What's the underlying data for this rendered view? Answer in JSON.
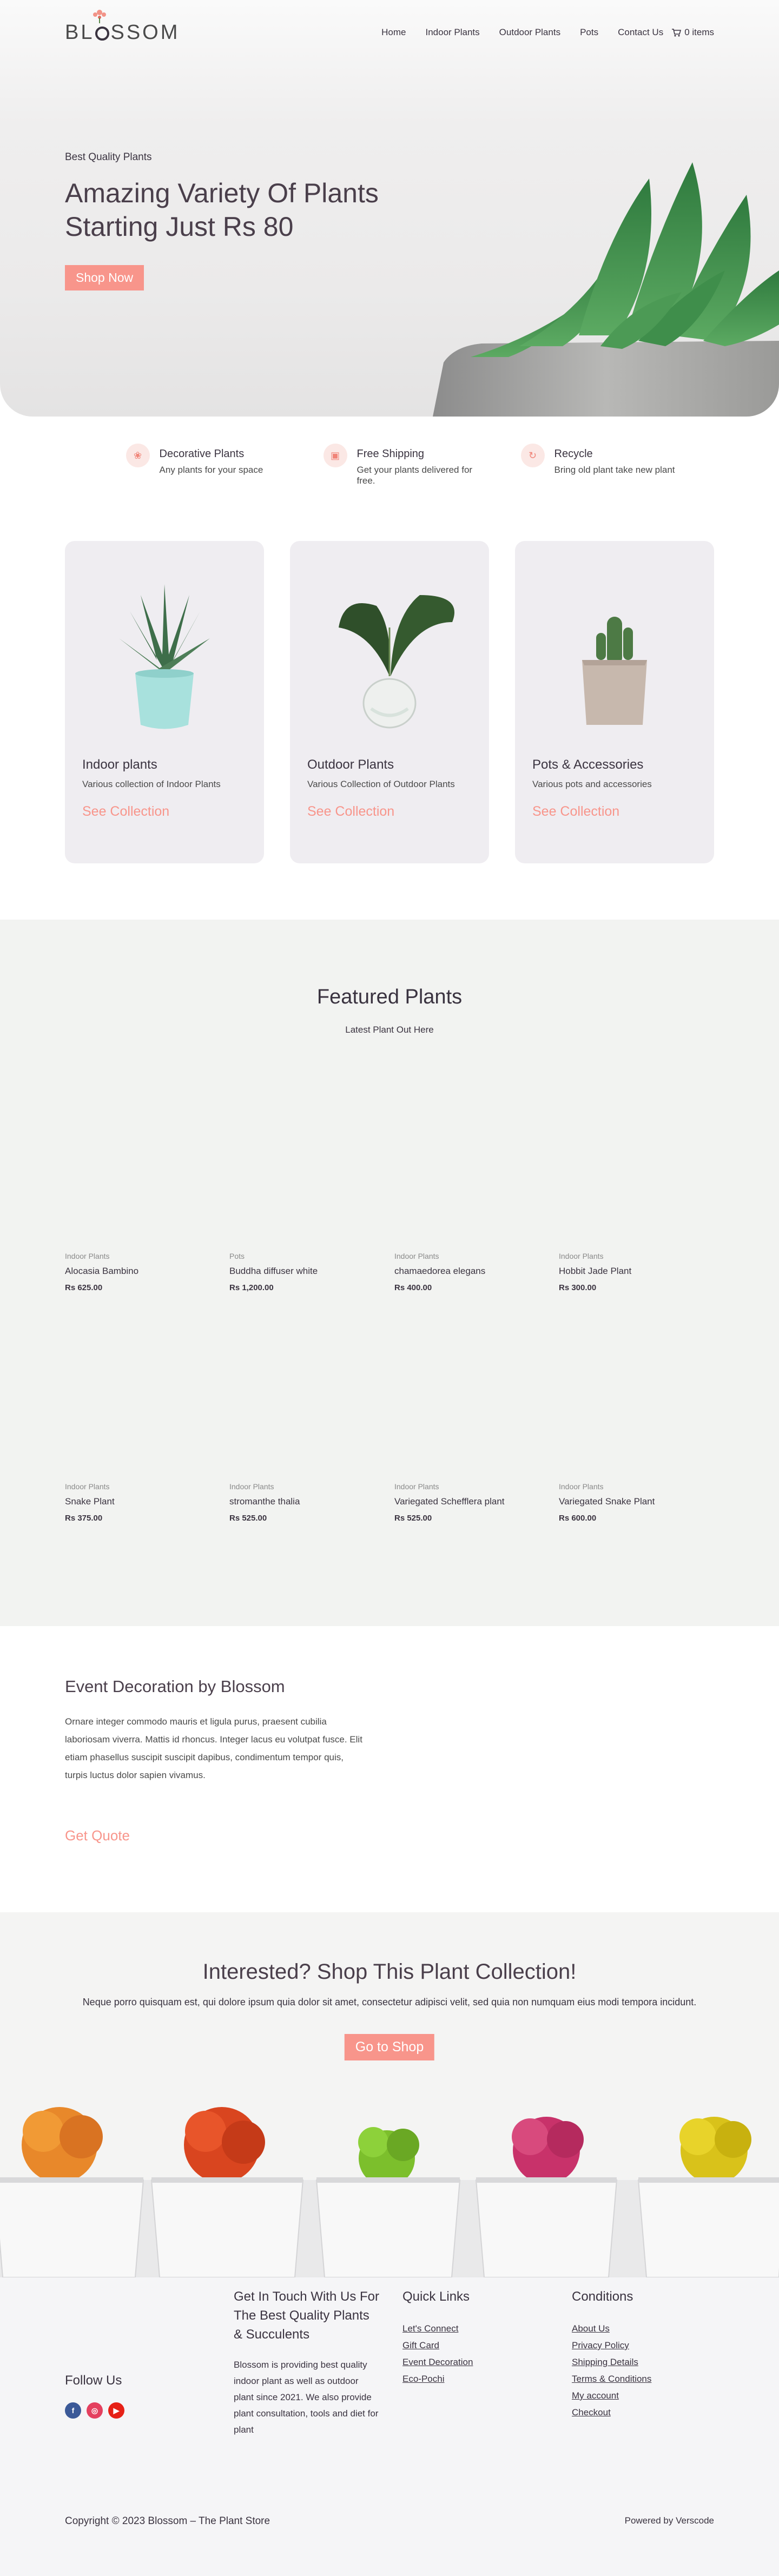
{
  "header": {
    "logo": "BLOSSOM",
    "nav": [
      "Home",
      "Indoor Plants",
      "Outdoor Plants",
      "Pots",
      "Contact Us"
    ],
    "cart": "0 items"
  },
  "hero": {
    "eyebrow": "Best Quality Plants",
    "title": "Amazing Variety Of Plants Starting Just Rs 80",
    "button": "Shop Now"
  },
  "features": [
    {
      "title": "Decorative Plants",
      "text": "Any plants for your space",
      "icon": "lotus-icon"
    },
    {
      "title": "Free Shipping",
      "text": "Get your plants delivered for free.",
      "icon": "box-icon"
    },
    {
      "title": "Recycle",
      "text": "Bring old plant take new plant",
      "icon": "recycle-icon"
    }
  ],
  "categories": [
    {
      "title": "Indoor plants",
      "text": "Various collection of Indoor Plants",
      "link": "See Collection"
    },
    {
      "title": "Outdoor Plants",
      "text": "Various Collection of Outdoor Plants",
      "link": "See Collection"
    },
    {
      "title": "Pots & Accessories",
      "text": "Various pots and accessories",
      "link": "See Collection"
    }
  ],
  "featured": {
    "title": "Featured Plants",
    "subtitle": "Latest Plant Out Here",
    "products": [
      {
        "category": "Indoor Plants",
        "name": "Alocasia Bambino",
        "price": "Rs 625.00"
      },
      {
        "category": "Pots",
        "name": "Buddha diffuser white",
        "price": "Rs 1,200.00"
      },
      {
        "category": "Indoor Plants",
        "name": "chamaedorea elegans",
        "price": "Rs 400.00"
      },
      {
        "category": "Indoor Plants",
        "name": "Hobbit Jade Plant",
        "price": "Rs 300.00"
      },
      {
        "category": "Indoor Plants",
        "name": "Snake Plant",
        "price": "Rs 375.00"
      },
      {
        "category": "Indoor Plants",
        "name": "stromanthe thalia",
        "price": "Rs 525.00"
      },
      {
        "category": "Indoor Plants",
        "name": "Variegated Schefflera plant",
        "price": "Rs 525.00"
      },
      {
        "category": "Indoor Plants",
        "name": "Variegated Snake Plant",
        "price": "Rs 600.00"
      }
    ]
  },
  "event": {
    "title": "Event Decoration by Blossom",
    "text": "Ornare integer commodo mauris et ligula purus, praesent cubilia laboriosam viverra. Mattis id rhoncus. Integer lacus eu volutpat fusce. Elit etiam phasellus suscipit suscipit dapibus, condimentum tempor quis, turpis luctus dolor sapien vivamus.",
    "link": "Get Quote"
  },
  "collection": {
    "title": "Interested? Shop This Plant Collection!",
    "text": "Neque porro quisquam est, qui dolore ipsum quia dolor sit amet, consectetur adipisci velit, sed quia non numquam eius modi tempora incidunt.",
    "button": "Go to Shop"
  },
  "footer": {
    "follow": "Follow Us",
    "contact_title": "Get In Touch With Us For The Best Quality Plants & Succulents",
    "contact_text": "Blossom is providing best quality indoor plant as well as outdoor plant since 2021. We also provide plant consultation, tools and diet for plant",
    "quick_title": "Quick Links",
    "quick_links": [
      "Let's Connect",
      "Gift Card",
      "Event Decoration",
      "Eco-Pochi"
    ],
    "cond_title": "Conditions",
    "cond_links": [
      "About Us",
      "Privacy Policy",
      "Shipping Details",
      "Terms & Conditions",
      "My account",
      "Checkout"
    ],
    "copyright": "Copyright © 2023 Blossom – The Plant Store",
    "powered": "Powered by Verscode"
  },
  "colors": {
    "accent": "#f8958b",
    "text": "#3a3340",
    "card": "#efedf1"
  }
}
